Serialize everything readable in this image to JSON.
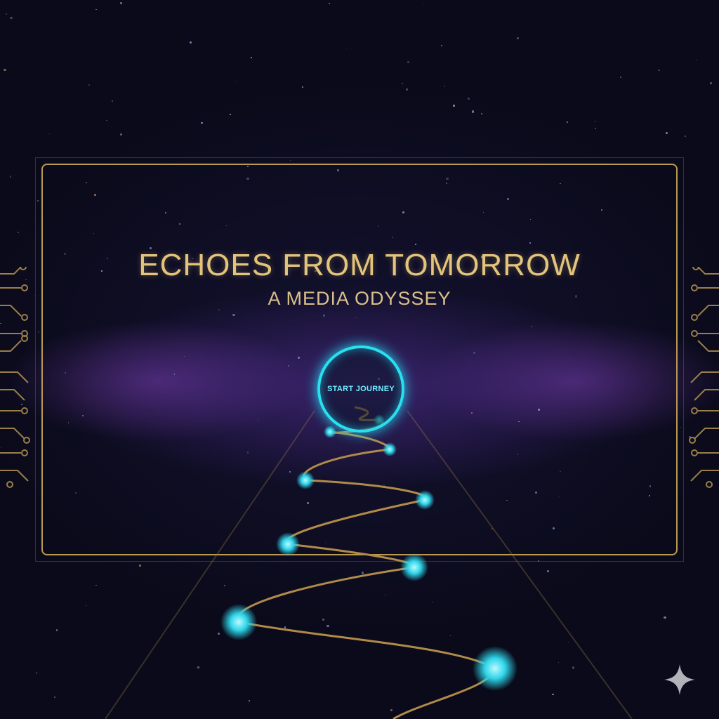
{
  "title": "ECHOES FROM TOMORROW",
  "subtitle": "A MEDIA ODYSSEY",
  "start_button": {
    "label": "START JOURNEY"
  },
  "colors": {
    "accent_gold": "#e3c47a",
    "frame_gold": "#b99a52",
    "accent_cyan": "#29e0f0",
    "background": "#0a0a1a"
  },
  "icons": {
    "corner": "sparkle-icon",
    "side_decoration": "circuit-icon"
  }
}
